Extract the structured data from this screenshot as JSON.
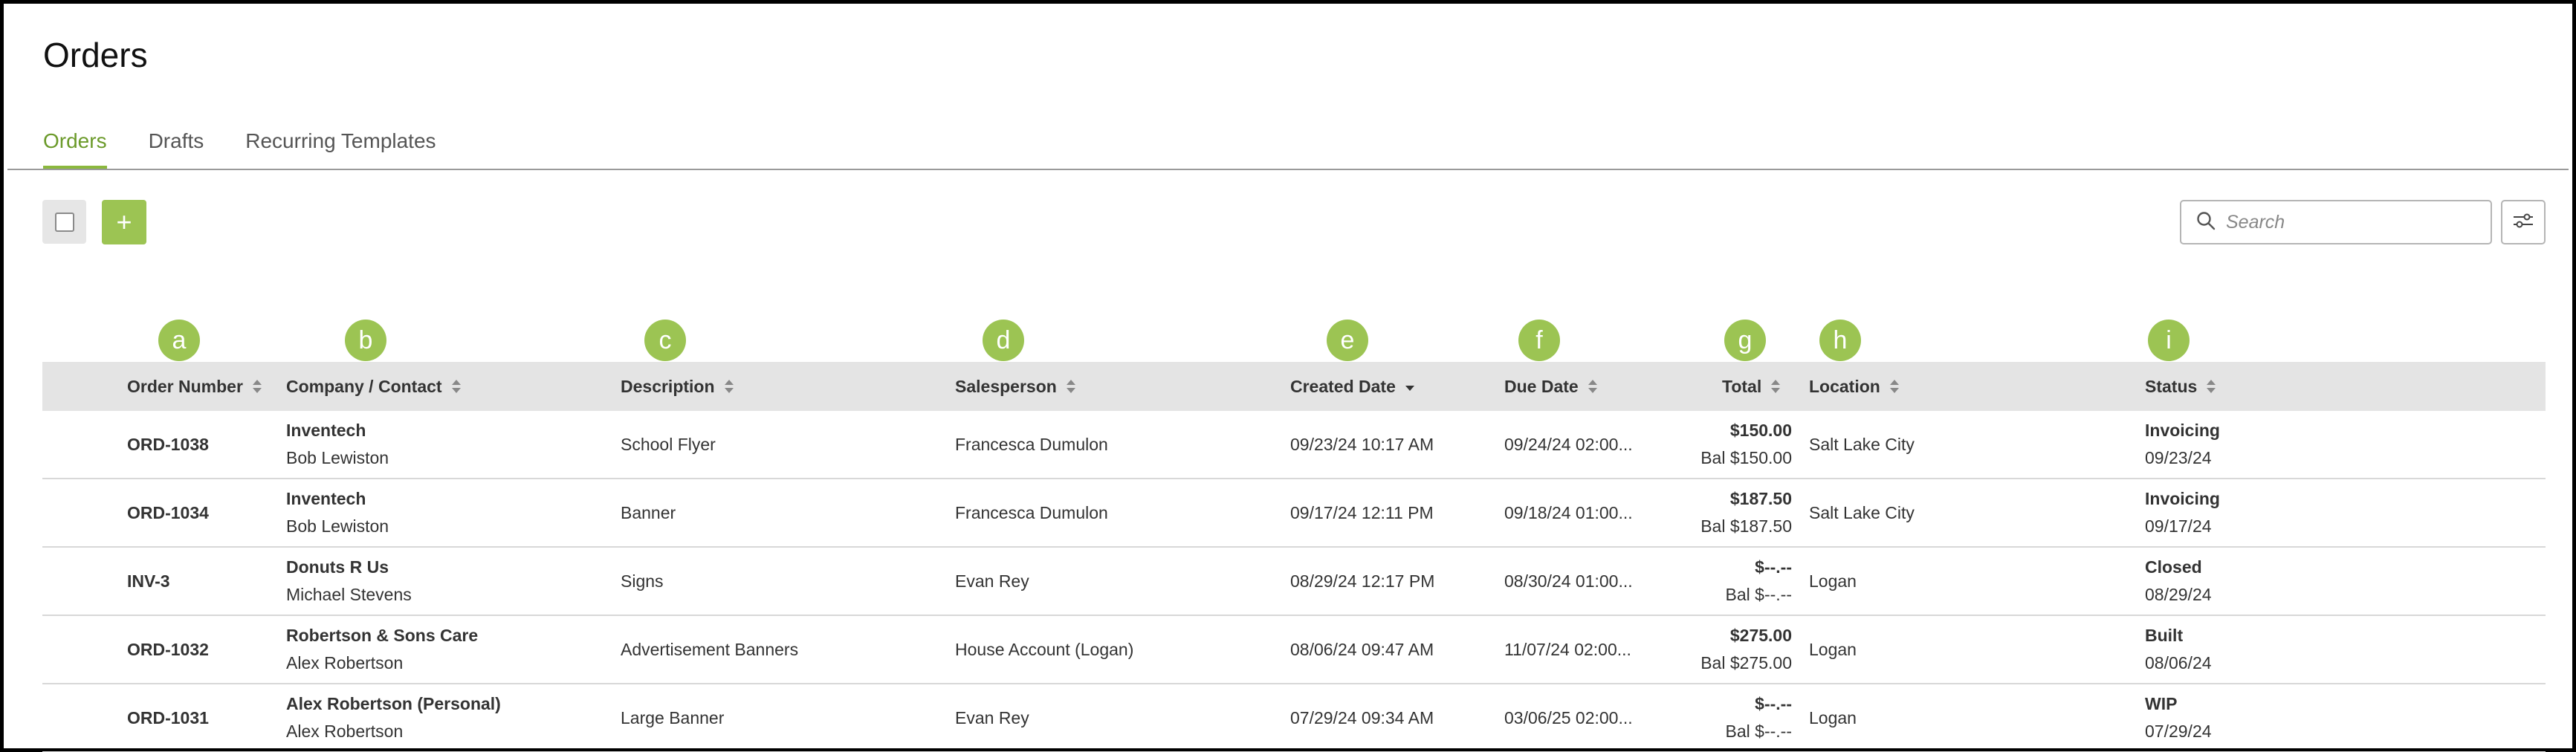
{
  "page": {
    "title": "Orders"
  },
  "tabs": [
    {
      "label": "Orders",
      "active": true
    },
    {
      "label": "Drafts",
      "active": false
    },
    {
      "label": "Recurring Templates",
      "active": false
    }
  ],
  "toolbar": {
    "add_label": "+",
    "search_placeholder": "Search",
    "search_value": ""
  },
  "colors": {
    "accent": "#9cc453",
    "accent_text": "#6b9a2a",
    "header_bg": "#e4e4e4"
  },
  "annotations": [
    "a",
    "b",
    "c",
    "d",
    "e",
    "f",
    "g",
    "h",
    "i"
  ],
  "table": {
    "columns": [
      {
        "key": "order",
        "label": "Order Number",
        "sort": "both"
      },
      {
        "key": "company",
        "label": "Company / Contact",
        "sort": "both"
      },
      {
        "key": "description",
        "label": "Description",
        "sort": "both"
      },
      {
        "key": "salesperson",
        "label": "Salesperson",
        "sort": "both"
      },
      {
        "key": "created",
        "label": "Created Date",
        "sort": "desc"
      },
      {
        "key": "due",
        "label": "Due Date",
        "sort": "both"
      },
      {
        "key": "total",
        "label": "Total",
        "sort": "both"
      },
      {
        "key": "location",
        "label": "Location",
        "sort": "both"
      },
      {
        "key": "status",
        "label": "Status",
        "sort": "both"
      }
    ],
    "rows": [
      {
        "order": "ORD-1038",
        "company": "Inventech",
        "contact": "Bob Lewiston",
        "description": "School Flyer",
        "salesperson": "Francesca Dumulon",
        "created": "09/23/24 10:17 AM",
        "due": "09/24/24 02:00...",
        "total": "$150.00",
        "balance": "Bal $150.00",
        "location": "Salt Lake City",
        "status": "Invoicing",
        "status_date": "09/23/24"
      },
      {
        "order": "ORD-1034",
        "company": "Inventech",
        "contact": "Bob Lewiston",
        "description": "Banner",
        "salesperson": "Francesca Dumulon",
        "created": "09/17/24 12:11 PM",
        "due": "09/18/24 01:00...",
        "total": "$187.50",
        "balance": "Bal $187.50",
        "location": "Salt Lake City",
        "status": "Invoicing",
        "status_date": "09/17/24"
      },
      {
        "order": "INV-3",
        "company": "Donuts R Us",
        "contact": "Michael Stevens",
        "description": "Signs",
        "salesperson": "Evan Rey",
        "created": "08/29/24 12:17 PM",
        "due": "08/30/24 01:00...",
        "total": "$--.--",
        "balance": "Bal $--.--",
        "location": "Logan",
        "status": "Closed",
        "status_date": "08/29/24"
      },
      {
        "order": "ORD-1032",
        "company": "Robertson & Sons Care",
        "contact": "Alex Robertson",
        "description": "Advertisement Banners",
        "salesperson": "House Account (Logan)",
        "created": "08/06/24 09:47 AM",
        "due": "11/07/24 02:00...",
        "total": "$275.00",
        "balance": "Bal $275.00",
        "location": "Logan",
        "status": "Built",
        "status_date": "08/06/24"
      },
      {
        "order": "ORD-1031",
        "company": "Alex Robertson (Personal)",
        "contact": "Alex Robertson",
        "description": "Large Banner",
        "salesperson": "Evan Rey",
        "created": "07/29/24 09:34 AM",
        "due": "03/06/25 02:00...",
        "total": "$--.--",
        "balance": "Bal $--.--",
        "location": "Logan",
        "status": "WIP",
        "status_date": "07/29/24"
      }
    ]
  }
}
